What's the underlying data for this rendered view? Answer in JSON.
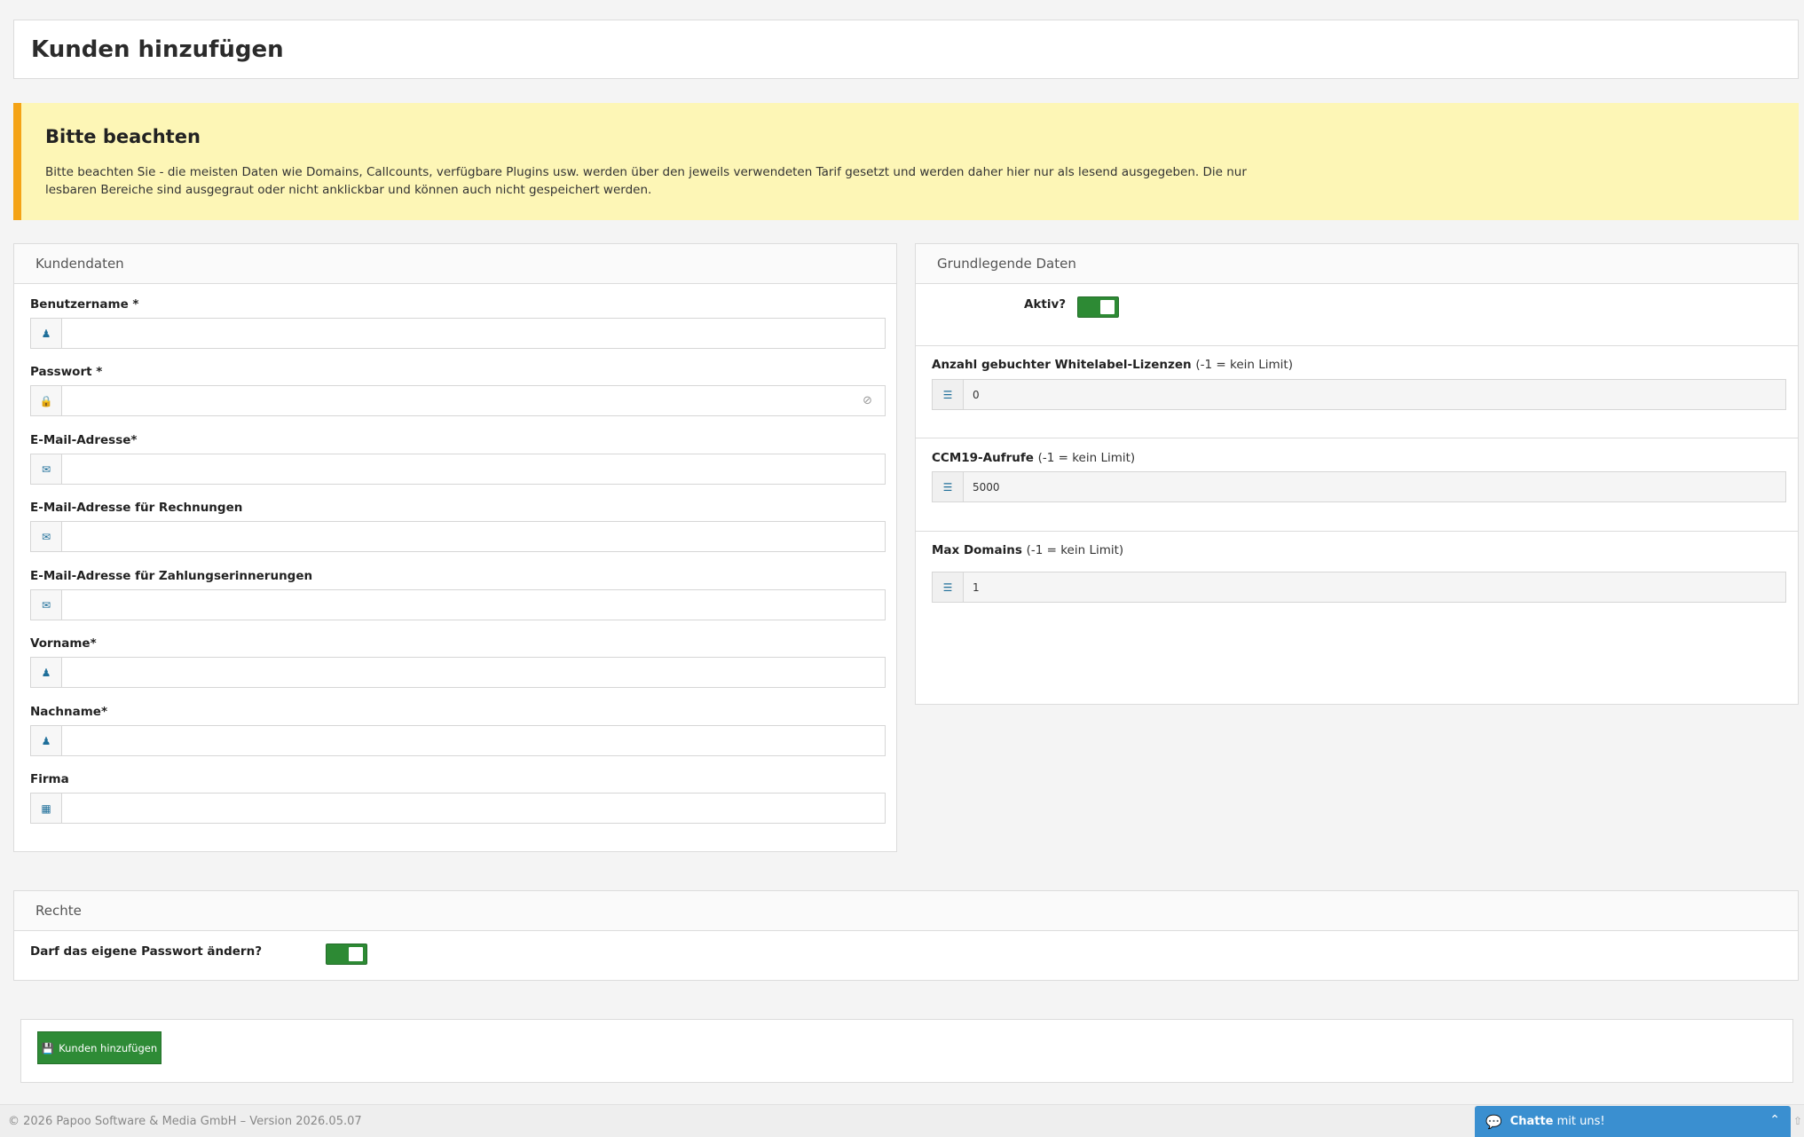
{
  "page": {
    "title": "Kunden hinzufügen"
  },
  "notice": {
    "title": "Bitte beachten",
    "text": "Bitte beachten Sie - die meisten Daten wie Domains, Callcounts, verfügbare Plugins usw. werden über den jeweils verwendeten Tarif gesetzt und werden daher hier nur als lesend ausgegeben. Die nur lesbaren Bereiche sind ausgegraut oder nicht anklickbar und können auch nicht gespeichert werden."
  },
  "customer": {
    "heading": "Kundendaten",
    "username_label": "Benutzername *",
    "password_label": "Passwort *",
    "email_label": "E-Mail-Adresse*",
    "invoice_email_label": "E-Mail-Adresse für Rechnungen",
    "reminder_email_label": "E-Mail-Adresse für Zahlungserinnerungen",
    "firstname_label": "Vorname*",
    "lastname_label": "Nachname*",
    "company_label": "Firma"
  },
  "basic": {
    "heading": "Grundlegende Daten",
    "active_label": "Aktiv?",
    "active": true,
    "whitelabel_label": "Anzahl gebuchter Whitelabel-Lizenzen",
    "whitelabel_hint": "(-1 = kein Limit)",
    "whitelabel_value": "0",
    "calls_label": "CCM19-Aufrufe",
    "calls_hint": "(-1 = kein Limit)",
    "calls_value": "5000",
    "domains_label": "Max Domains",
    "domains_hint": "(-1 = kein Limit)",
    "domains_value": "1"
  },
  "rights": {
    "heading": "Rechte",
    "change_password_label": "Darf das eigene Passwort ändern?",
    "change_password": true
  },
  "actions": {
    "submit_label": "Kunden hinzufügen"
  },
  "footer": {
    "text": "© 2026 Papoo Software & Media GmbH – Version 2026.05.07"
  },
  "chat": {
    "label_bold": "Chatte",
    "label_rest": " mit uns!"
  },
  "colors": {
    "accent_green": "#2e8b36",
    "notice_bg": "#fdf6b6",
    "notice_border": "#f4a316",
    "chat_blue": "#3a8fd0",
    "icon_blue": "#1f6f9a"
  }
}
